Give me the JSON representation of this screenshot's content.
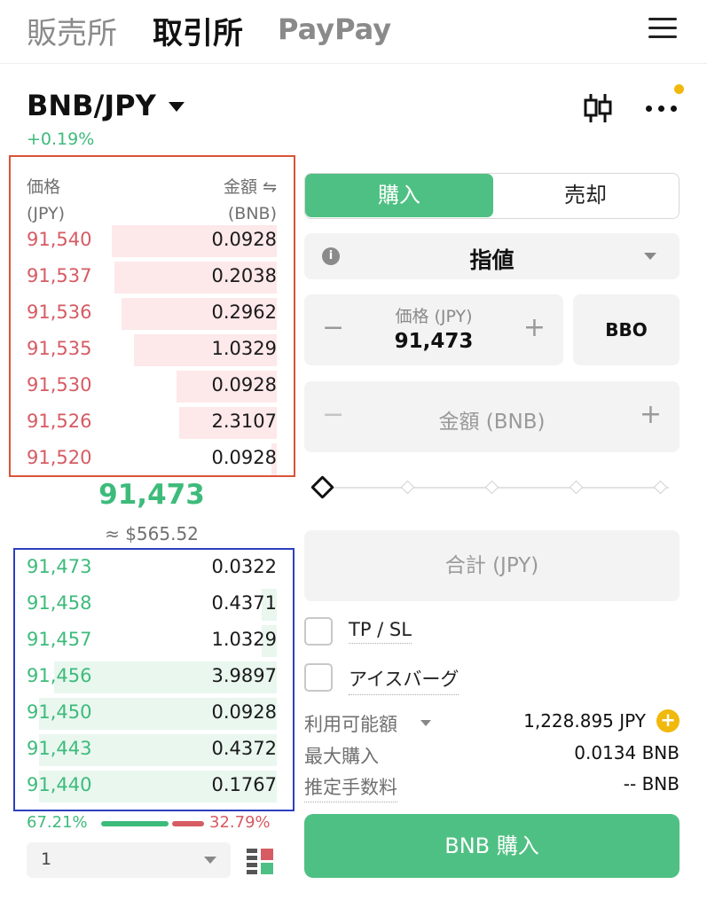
{
  "nav": {
    "tabs": [
      "販売所",
      "取引所",
      "PayPay"
    ]
  },
  "pair": {
    "symbol": "BNB/JPY",
    "change": "+0.19%"
  },
  "book": {
    "header": {
      "price_label": "価格",
      "price_unit": "(JPY)",
      "amount_label": "金額 ⇋",
      "amount_unit": "(BNB)"
    },
    "asks": [
      {
        "price": "91,540",
        "qty": "0.0928",
        "depth": 0.66
      },
      {
        "price": "91,537",
        "qty": "0.2038",
        "depth": 0.65
      },
      {
        "price": "91,536",
        "qty": "0.2962",
        "depth": 0.62
      },
      {
        "price": "91,535",
        "qty": "1.0329",
        "depth": 0.57
      },
      {
        "price": "91,530",
        "qty": "0.0928",
        "depth": 0.4
      },
      {
        "price": "91,526",
        "qty": "2.3107",
        "depth": 0.39
      },
      {
        "price": "91,520",
        "qty": "0.0928",
        "depth": 0.02
      }
    ],
    "last_price": "91,473",
    "usd_price": "≈ $565.52",
    "bids": [
      {
        "price": "91,473",
        "qty": "0.0322",
        "depth": 0.0
      },
      {
        "price": "91,458",
        "qty": "0.4371",
        "depth": 0.06
      },
      {
        "price": "91,457",
        "qty": "1.0329",
        "depth": 0.06
      },
      {
        "price": "91,456",
        "qty": "3.9897",
        "depth": 0.89
      },
      {
        "price": "91,450",
        "qty": "0.0928",
        "depth": 0.95
      },
      {
        "price": "91,443",
        "qty": "0.4372",
        "depth": 0.95
      },
      {
        "price": "91,440",
        "qty": "0.1767",
        "depth": 0.95
      }
    ],
    "buy_ratio": "67.21%",
    "sell_ratio": "32.79%",
    "depth_select": "1"
  },
  "trade": {
    "buy_label": "購入",
    "sell_label": "売却",
    "order_type": "指値",
    "info_glyph": "i",
    "price_label": "価格 (JPY)",
    "price_value": "91,473",
    "minus": "−",
    "plus": "+",
    "bbo_label": "BBO",
    "amount_label": "金額 (BNB)",
    "total_label": "合計 (JPY)",
    "tpsl_label": "TP / SL",
    "iceberg_label": "アイスバーグ",
    "available_label": "利用可能額",
    "available_value": "1,228.895 JPY",
    "max_buy_label": "最大購入",
    "max_buy_value": "0.0134 BNB",
    "fee_label": "推定手数料",
    "fee_value": "-- BNB",
    "submit_label": "BNB 購入"
  },
  "colors": {
    "buy": "#4fc083",
    "sell": "#d65b63",
    "accent": "#f0b90b"
  }
}
